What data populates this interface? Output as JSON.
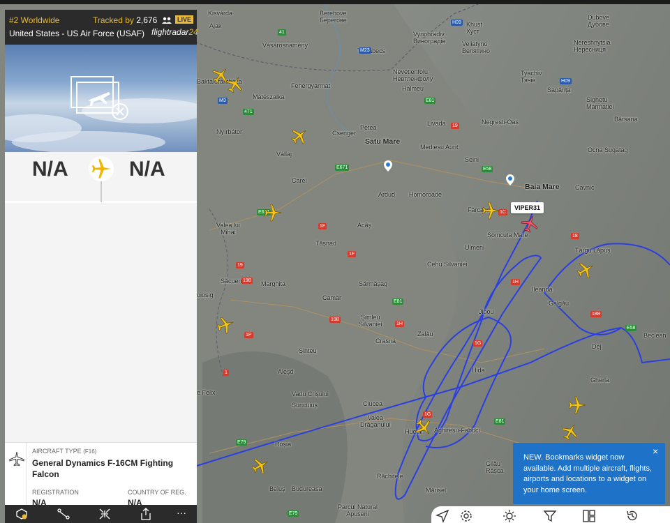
{
  "map": {
    "towns": [
      {
        "name": "Kisvárda",
        "big": false
      },
      {
        "name": "Berehove\nБерегове",
        "big": false
      },
      {
        "name": "Khust\nХуст",
        "big": false
      },
      {
        "name": "Dubove\nДубове",
        "big": false
      },
      {
        "name": "Ajak",
        "big": false
      },
      {
        "name": "Vynohradiv\nВиноградів",
        "big": false
      },
      {
        "name": "Veliatyno\nВелятино",
        "big": false
      },
      {
        "name": "Nereshnytsia\nНересниця",
        "big": false
      },
      {
        "name": "Vásárosnamény",
        "big": false
      },
      {
        "name": "Tiszabecs",
        "big": false
      },
      {
        "name": "Nevetlenfolu\nНевтленфолу",
        "big": false
      },
      {
        "name": "Halmeu",
        "big": false
      },
      {
        "name": "Tyachiv\nТячів",
        "big": false
      },
      {
        "name": "Sapânța",
        "big": false
      },
      {
        "name": "Baktalórántháza",
        "big": false
      },
      {
        "name": "Fehérgyarmat",
        "big": false
      },
      {
        "name": "Mátészalka",
        "big": false
      },
      {
        "name": "Sighetu\nMarmației",
        "big": false
      },
      {
        "name": "Livada",
        "big": false
      },
      {
        "name": "Negrești-Oaș",
        "big": false
      },
      {
        "name": "Bârsana",
        "big": false
      },
      {
        "name": "Nyírbátor",
        "big": false
      },
      {
        "name": "Csenger",
        "big": false
      },
      {
        "name": "Petea",
        "big": false
      },
      {
        "name": "Ocna Șugatag",
        "big": false
      },
      {
        "name": "Vállaj",
        "big": false
      },
      {
        "name": "Satu Mare",
        "big": true
      },
      {
        "name": "Medieșu Aurit",
        "big": false
      },
      {
        "name": "Seini",
        "big": false
      },
      {
        "name": "Baia Mare",
        "big": true
      },
      {
        "name": "Cavnic",
        "big": false
      },
      {
        "name": "Carei",
        "big": false
      },
      {
        "name": "Ardud",
        "big": false
      },
      {
        "name": "Homoroade",
        "big": false
      },
      {
        "name": "Fărcașa",
        "big": false
      },
      {
        "name": "Valea lui\nMihai",
        "big": false
      },
      {
        "name": "Acâș",
        "big": false
      },
      {
        "name": "Șomcuta Mare",
        "big": false
      },
      {
        "name": "Tășnad",
        "big": false
      },
      {
        "name": "Ulmeni",
        "big": false
      },
      {
        "name": "Târgu Lăpuș",
        "big": false
      },
      {
        "name": "Cehu Silvaniei",
        "big": false
      },
      {
        "name": "Săcueni",
        "big": false
      },
      {
        "name": "Marghita",
        "big": false
      },
      {
        "name": "Sărmășag",
        "big": false
      },
      {
        "name": "Ileanda",
        "big": false
      },
      {
        "name": "Galgău",
        "big": false
      },
      {
        "name": "oiosig",
        "big": false
      },
      {
        "name": "Camăr",
        "big": false
      },
      {
        "name": "Jibou",
        "big": false
      },
      {
        "name": "Șimleu\nSilvaniei",
        "big": false
      },
      {
        "name": "Zalău",
        "big": false
      },
      {
        "name": "Crasna",
        "big": false
      },
      {
        "name": "Dej",
        "big": false
      },
      {
        "name": "Beclean",
        "big": false
      },
      {
        "name": "Șinteu",
        "big": false
      },
      {
        "name": "Aleșd",
        "big": false
      },
      {
        "name": "Hida",
        "big": false
      },
      {
        "name": "Gherla",
        "big": false
      },
      {
        "name": "e Felix",
        "big": false
      },
      {
        "name": "Vadu Crișului",
        "big": false
      },
      {
        "name": "Șuncuiuș",
        "big": false
      },
      {
        "name": "Ciucea",
        "big": false
      },
      {
        "name": "Valea\nDrăganului",
        "big": false
      },
      {
        "name": "Huedin",
        "big": false
      },
      {
        "name": "Aghireșu-Fabrici",
        "big": false
      },
      {
        "name": "Roșia",
        "big": false
      },
      {
        "name": "Gilău",
        "big": false
      },
      {
        "name": "Rășca",
        "big": false
      },
      {
        "name": "Beiuș",
        "big": false
      },
      {
        "name": "Budureasa",
        "big": false
      },
      {
        "name": "Răchițele",
        "big": false
      },
      {
        "name": "Mărișel",
        "big": false
      },
      {
        "name": "Parcul Natural\nApuseni",
        "big": false
      }
    ],
    "roads": [
      {
        "label": "41",
        "kind": "g"
      },
      {
        "label": "M23",
        "kind": "b"
      },
      {
        "label": "H09",
        "kind": "b"
      },
      {
        "label": "H09",
        "kind": "b"
      },
      {
        "label": "M3",
        "kind": "b"
      },
      {
        "label": "471",
        "kind": "g"
      },
      {
        "label": "E81",
        "kind": "g"
      },
      {
        "label": "19",
        "kind": "r"
      },
      {
        "label": "E671",
        "kind": "g"
      },
      {
        "label": "E58",
        "kind": "g"
      },
      {
        "label": "E671",
        "kind": "g"
      },
      {
        "label": "1C",
        "kind": "r"
      },
      {
        "label": "1F",
        "kind": "r"
      },
      {
        "label": "1F",
        "kind": "r"
      },
      {
        "label": "19",
        "kind": "r"
      },
      {
        "label": "19B",
        "kind": "r"
      },
      {
        "label": "1H",
        "kind": "r"
      },
      {
        "label": "E81",
        "kind": "g"
      },
      {
        "label": "19B",
        "kind": "r"
      },
      {
        "label": "1H",
        "kind": "r"
      },
      {
        "label": "1G",
        "kind": "r"
      },
      {
        "label": "1P",
        "kind": "r"
      },
      {
        "label": "1",
        "kind": "r"
      },
      {
        "label": "E58",
        "kind": "g"
      },
      {
        "label": "1G",
        "kind": "r"
      },
      {
        "label": "E81",
        "kind": "g"
      },
      {
        "label": "E79",
        "kind": "g"
      },
      {
        "label": "E79",
        "kind": "g"
      },
      {
        "label": "18",
        "kind": "r"
      },
      {
        "label": "18B",
        "kind": "r"
      }
    ],
    "callsign": "VIPER31"
  },
  "panel": {
    "rank": "#2 Worldwide",
    "tracked_prefix": "Tracked by ",
    "tracked_count": "2,676",
    "live": "LIVE",
    "owner": "United States - US Air Force (USAF)",
    "logo_a": "flightradar",
    "logo_b": "24",
    "origin": "N/A",
    "destination": "N/A",
    "aircraft_type_label": "AIRCRAFT TYPE",
    "aircraft_type_code": "(F16)",
    "aircraft_type": "General Dynamics F-16CM Fighting Falcon",
    "registration_label": "REGISTRATION",
    "registration": "N/A",
    "country_label": "COUNTRY OF REG.",
    "country": "N/A",
    "footer_more": "···"
  },
  "notice": {
    "text": "NEW. Bookmarks widget now available. Add multiple aircraft, flights, airports and locations to a widget on your home screen.",
    "close": "×"
  },
  "colors": {
    "track": "#2b3fe0",
    "plane": "#f5c518",
    "selected": "#e85a6a",
    "accent": "#e8b93b",
    "notice": "#1e73c8"
  }
}
